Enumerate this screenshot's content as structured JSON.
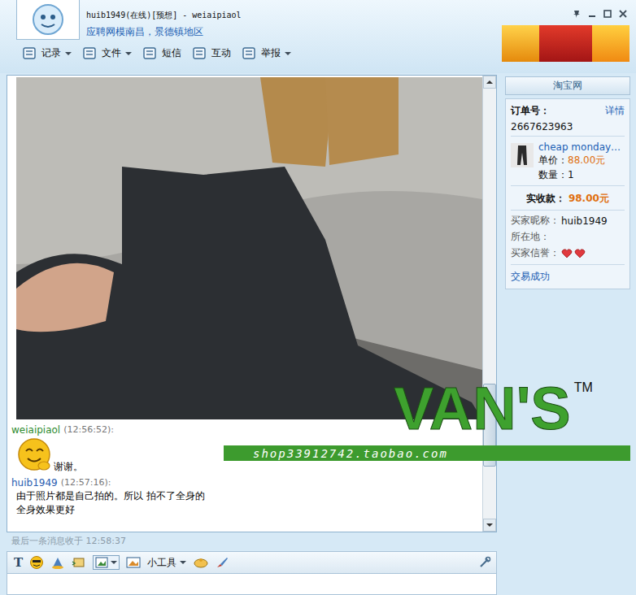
{
  "window": {
    "title": "huib1949(在线)[预想] - weiaipiaol",
    "subtitle": "应聘网模南昌，景德镇地区"
  },
  "toolbar": [
    {
      "label": "记录",
      "dropdown": true
    },
    {
      "label": "文件",
      "dropdown": true
    },
    {
      "label": "短信",
      "dropdown": false
    },
    {
      "label": "互动",
      "dropdown": false
    },
    {
      "label": "举报",
      "dropdown": true
    }
  ],
  "chat": {
    "scroll_level": 0.85,
    "messages": [
      {
        "sender": "weiaipiaol",
        "time": "(12:56:52):",
        "emoji": true,
        "lines": [
          "谢谢。"
        ],
        "color": "#2e8b2e"
      },
      {
        "sender": "huib1949",
        "time": "(12:57:16):",
        "emoji": false,
        "lines": [
          "由于照片都是自己拍的。所以 拍不了全身的",
          "全身效果更好"
        ],
        "color": "#2a5db0"
      }
    ],
    "last_received": "最后一条消息收于 12:58:37"
  },
  "input_toolbar": {
    "font_icon": "T",
    "tools_label": "小工具"
  },
  "order_panel": {
    "header": "淘宝网",
    "order_label": "订单号：",
    "details_link": "详情",
    "order_number": "2667623963",
    "product": {
      "name": "cheap monday…",
      "price_label": "单价：",
      "price": "88.00元",
      "quantity_label": "数量：",
      "quantity": "1"
    },
    "paid_label": "实收款：",
    "paid": "98.00元",
    "buyer": [
      {
        "label": "买家昵称：",
        "value": "huib1949"
      },
      {
        "label": "所在地：",
        "value": ""
      }
    ],
    "reputation_label": "买家信誉：",
    "reputation_hearts": 2,
    "status": "交易成功"
  },
  "watermark": {
    "brand": "VAN'S",
    "trademark": "TM",
    "url": "shop33912742.taobao.com"
  }
}
